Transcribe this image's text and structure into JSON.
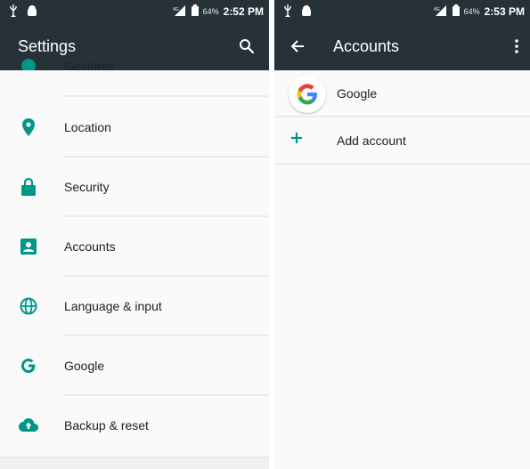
{
  "left_screen": {
    "status": {
      "battery": "64%",
      "time": "2:52 PM"
    },
    "title": "Settings",
    "partial_item_label": "Gestures",
    "items": [
      {
        "label": "Location",
        "icon": "location-pin-icon"
      },
      {
        "label": "Security",
        "icon": "lock-icon"
      },
      {
        "label": "Accounts",
        "icon": "account-box-icon"
      },
      {
        "label": "Language & input",
        "icon": "globe-icon"
      },
      {
        "label": "Google",
        "icon": "google-g-icon"
      },
      {
        "label": "Backup & reset",
        "icon": "cloud-upload-icon"
      }
    ]
  },
  "right_screen": {
    "status": {
      "battery": "64%",
      "time": "2:53 PM"
    },
    "title": "Accounts",
    "items": [
      {
        "label": "Google",
        "icon": "google-logo-icon"
      },
      {
        "label": "Add account",
        "icon": "plus-icon"
      }
    ]
  },
  "colors": {
    "app_bar": "#263238",
    "accent": "#009688",
    "background": "#fafafa",
    "text": "#212121"
  }
}
